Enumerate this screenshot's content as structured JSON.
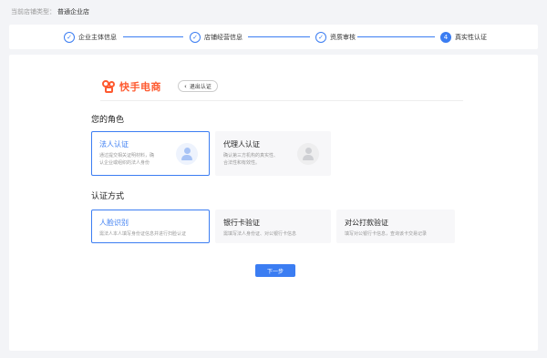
{
  "store_type": {
    "label": "当前店铺类型：",
    "value": "普通企业店"
  },
  "steps": [
    {
      "label": "企业主体信息",
      "status": "done"
    },
    {
      "label": "店铺经营信息",
      "status": "done"
    },
    {
      "label": "资质审核",
      "status": "done"
    },
    {
      "label": "真实性认证",
      "status": "current",
      "number": "4"
    }
  ],
  "brand": {
    "name": "快手电商",
    "color": "#fe5a30"
  },
  "back_button": {
    "label": "退出认证"
  },
  "role_section": {
    "title": "您的角色",
    "options": [
      {
        "title": "法人认证",
        "desc_line1": "通过提交相关证明材料，确",
        "desc_line2": "认企业或组织的法人身份",
        "icon": "user-avatar-icon",
        "selected": true
      },
      {
        "title": "代理人认证",
        "desc_line1": "确认第三方机构的真实性、",
        "desc_line2": "合法性和有效性。",
        "icon": "user-avatar-icon",
        "selected": false
      }
    ]
  },
  "method_section": {
    "title": "认证方式",
    "options": [
      {
        "title": "人脸识别",
        "desc": "需法人本人填写身份证信息并进行扫脸认证",
        "selected": true
      },
      {
        "title": "银行卡验证",
        "desc": "需填写法人身份证、对公银行卡信息",
        "selected": false
      },
      {
        "title": "对公打款验证",
        "desc": "填写对公银行卡信息，查询该卡交易记录",
        "selected": false
      }
    ]
  },
  "next_button": {
    "label": "下一步"
  },
  "colors": {
    "accent": "#3b7df2",
    "background": "#f3f4f7"
  }
}
